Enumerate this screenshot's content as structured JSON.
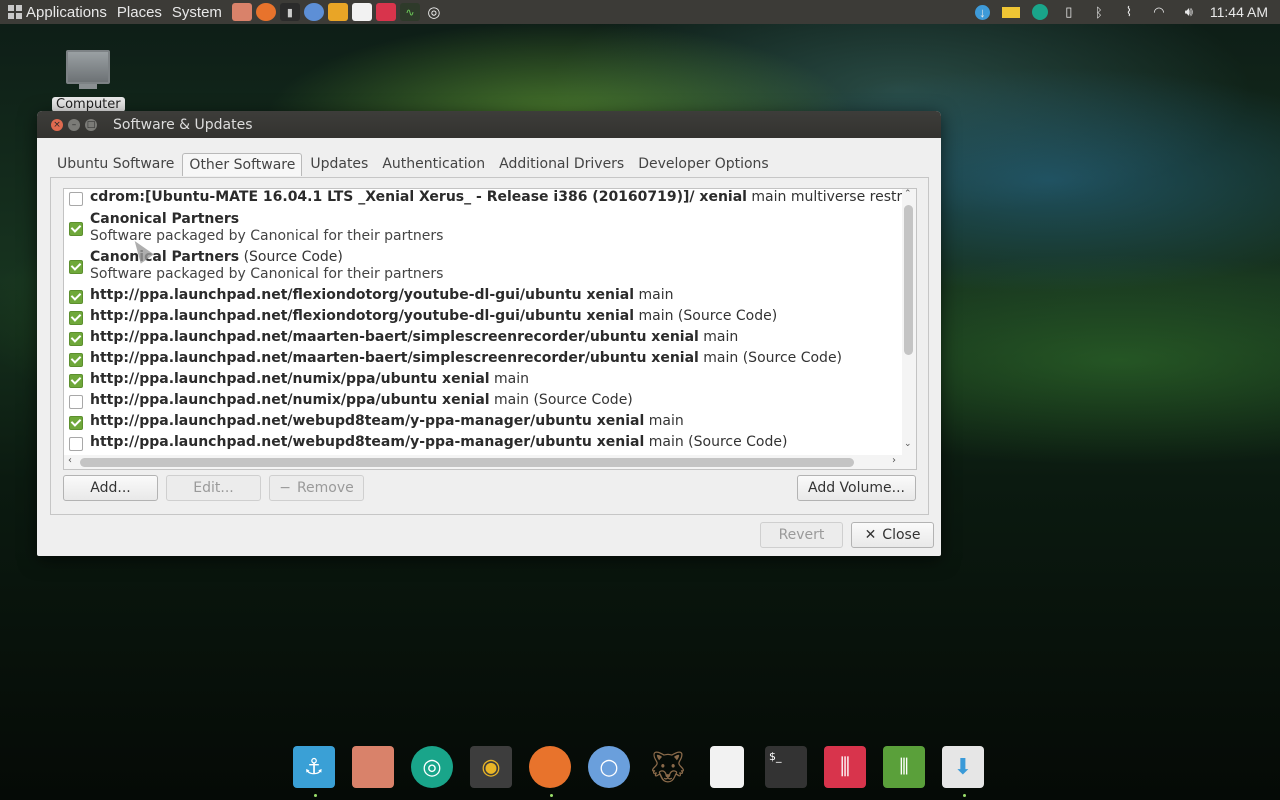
{
  "top_panel": {
    "menus": [
      "Applications",
      "Places",
      "System"
    ],
    "clock": "11:44 AM"
  },
  "desktop": {
    "computer_label": "Computer"
  },
  "window": {
    "title": "Software & Updates",
    "tabs": [
      {
        "label": "Ubuntu Software"
      },
      {
        "label": "Other Software"
      },
      {
        "label": "Updates"
      },
      {
        "label": "Authentication"
      },
      {
        "label": "Additional Drivers"
      },
      {
        "label": "Developer Options"
      }
    ],
    "active_tab": "Other Software",
    "sources": [
      {
        "checked": false,
        "bold": "cdrom:[Ubuntu-MATE 16.04.1 LTS _Xenial Xerus_ - Release i386 (20160719)]/ xenial",
        "rest": " main multiverse restricted univ"
      },
      {
        "checked": true,
        "bold": "Canonical Partners",
        "rest": "",
        "sub": "Software packaged by Canonical for their partners"
      },
      {
        "checked": true,
        "bold": "Canonical Partners",
        "rest": " (Source Code)",
        "sub": "Software packaged by Canonical for their partners"
      },
      {
        "checked": true,
        "bold": "http://ppa.launchpad.net/flexiondotorg/youtube-dl-gui/ubuntu xenial",
        "rest": " main"
      },
      {
        "checked": true,
        "bold": "http://ppa.launchpad.net/flexiondotorg/youtube-dl-gui/ubuntu xenial",
        "rest": " main (Source Code)"
      },
      {
        "checked": true,
        "bold": "http://ppa.launchpad.net/maarten-baert/simplescreenrecorder/ubuntu xenial",
        "rest": " main"
      },
      {
        "checked": true,
        "bold": "http://ppa.launchpad.net/maarten-baert/simplescreenrecorder/ubuntu xenial",
        "rest": " main (Source Code)"
      },
      {
        "checked": true,
        "bold": "http://ppa.launchpad.net/numix/ppa/ubuntu xenial",
        "rest": " main"
      },
      {
        "checked": false,
        "bold": "http://ppa.launchpad.net/numix/ppa/ubuntu xenial",
        "rest": " main (Source Code)"
      },
      {
        "checked": true,
        "bold": "http://ppa.launchpad.net/webupd8team/y-ppa-manager/ubuntu xenial",
        "rest": " main"
      },
      {
        "checked": false,
        "bold": "http://ppa.launchpad.net/webupd8team/y-ppa-manager/ubuntu xenial",
        "rest": " main (Source Code)"
      }
    ],
    "buttons": {
      "add": "Add...",
      "edit": "Edit...",
      "remove": "Remove",
      "add_volume": "Add Volume...",
      "revert": "Revert",
      "close": "Close"
    }
  },
  "dock": {
    "items": [
      "anchor-icon",
      "files-icon",
      "synapse-icon",
      "rhythmbox-icon",
      "firefox-icon",
      "chromium-icon",
      "gimp-icon",
      "document-icon",
      "terminal-icon",
      "mixer-icon",
      "trash-icon",
      "installer-icon"
    ]
  }
}
